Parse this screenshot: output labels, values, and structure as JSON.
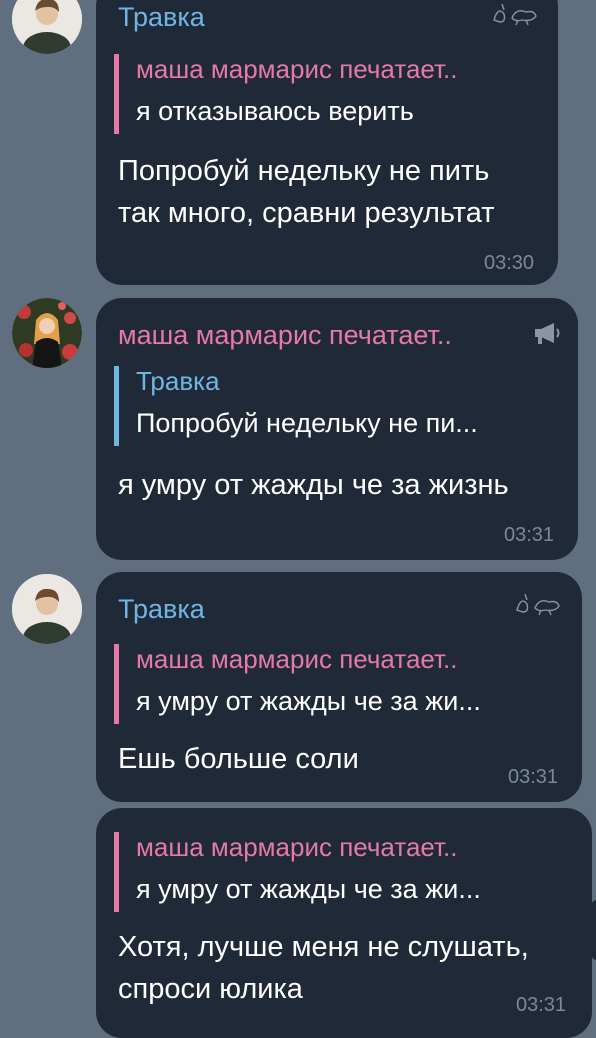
{
  "colors": {
    "background": "#5f6f80",
    "bubble": "#1f2937",
    "name_blue": "#6fb6e0",
    "name_pink": "#e57aa6",
    "time": "#7b8896"
  },
  "messages": [
    {
      "sender": "Травка",
      "reply_name": "маша мармарис печатает..",
      "reply_text": "я отказываюсь верить",
      "text": "Попробуй недельку не пить\nтак много, сравни результат",
      "time": "03:30",
      "icon": "goose-sticker-icon"
    },
    {
      "sender": "маша мармарис печатает..",
      "reply_name": "Травка",
      "reply_text": "Попробуй недельку не пи...",
      "text": "я умру от жажды че за жизнь",
      "time": "03:31",
      "icon": "megaphone-icon"
    },
    {
      "sender": "Травка",
      "reply_name": "маша мармарис печатает..",
      "reply_text": "я умру от жажды че за жи...",
      "text": "Ешь больше соли",
      "time": "03:31",
      "icon": "goose-sticker-icon"
    },
    {
      "reply_name": "маша мармарис печатает..",
      "reply_text": "я умру от жажды че за жи...",
      "text": "Хотя, лучше меня не слушать,\nспроси юлика",
      "time": "03:31"
    }
  ]
}
